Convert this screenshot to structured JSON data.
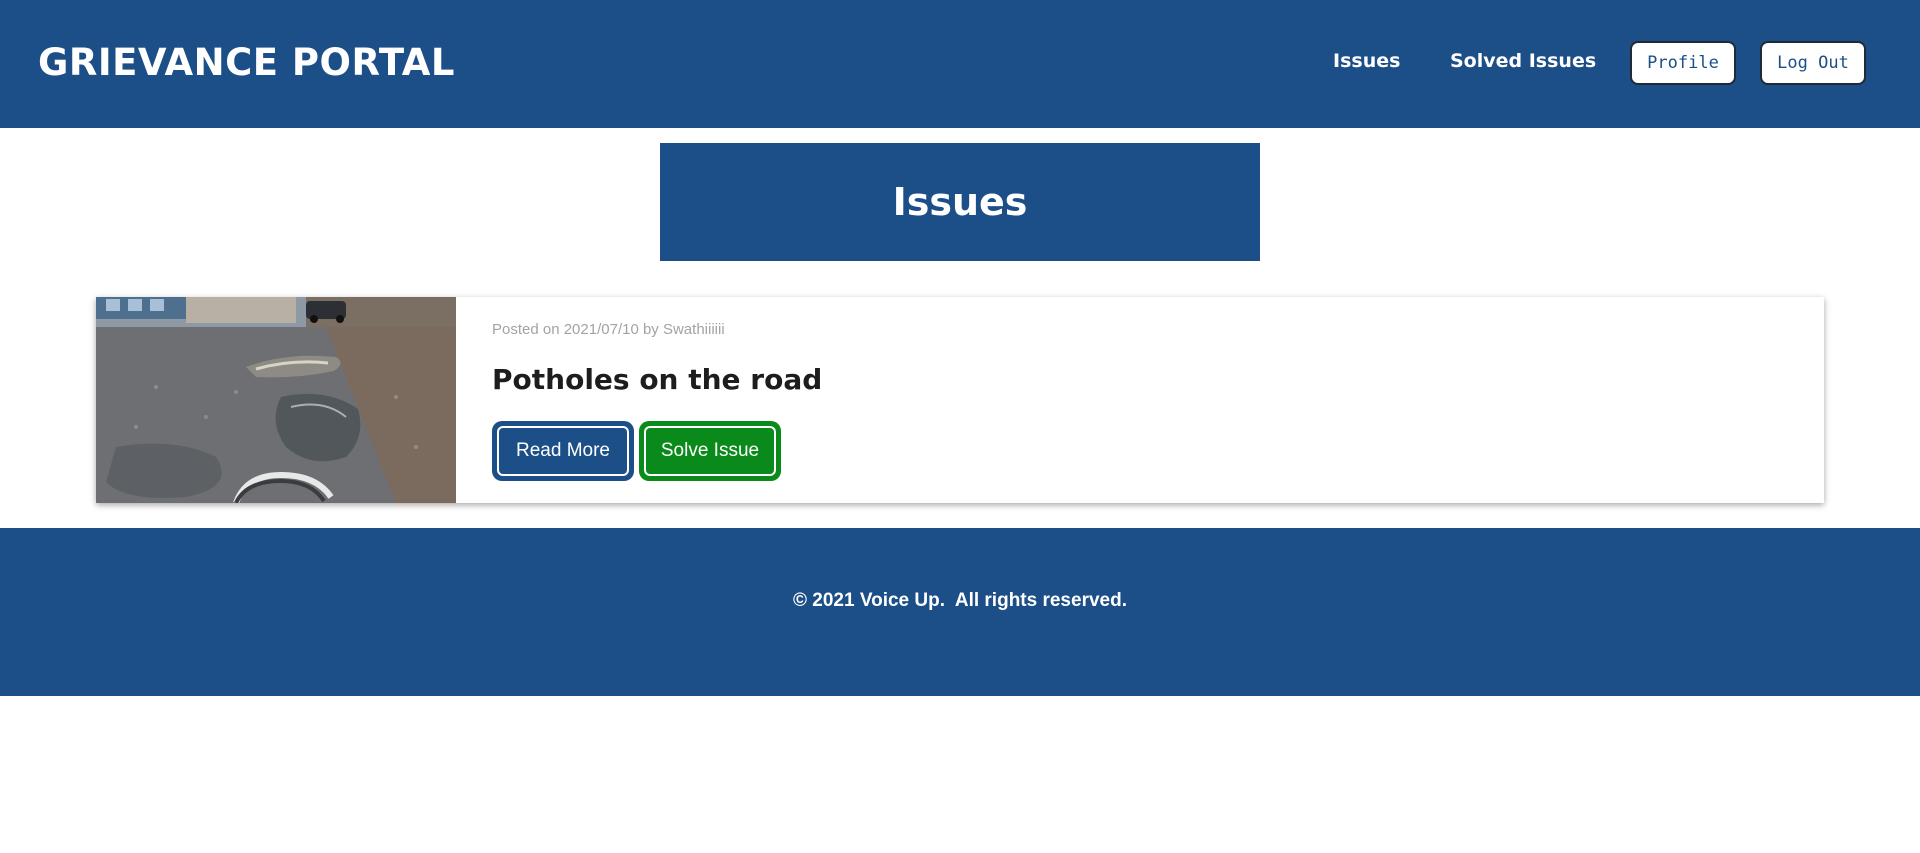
{
  "header": {
    "brand": "GRIEVANCE PORTAL",
    "nav": {
      "issues_label": "Issues",
      "solved_label": "Solved Issues",
      "profile_label": "Profile",
      "logout_label": "Log Out"
    }
  },
  "main": {
    "title": "Issues",
    "issues": [
      {
        "meta": "Posted on 2021/07/10 by Swathiiiiii",
        "title": "Potholes on the road",
        "read_more_label": "Read More",
        "solve_label": "Solve Issue"
      }
    ]
  },
  "footer": {
    "copyright": "© 2021 Voice Up.  All rights reserved."
  },
  "colors": {
    "primary": "#1c4f87",
    "success": "#0a8a1a",
    "meta_text": "#a3a3a3",
    "title_text": "#1d1d1d"
  }
}
